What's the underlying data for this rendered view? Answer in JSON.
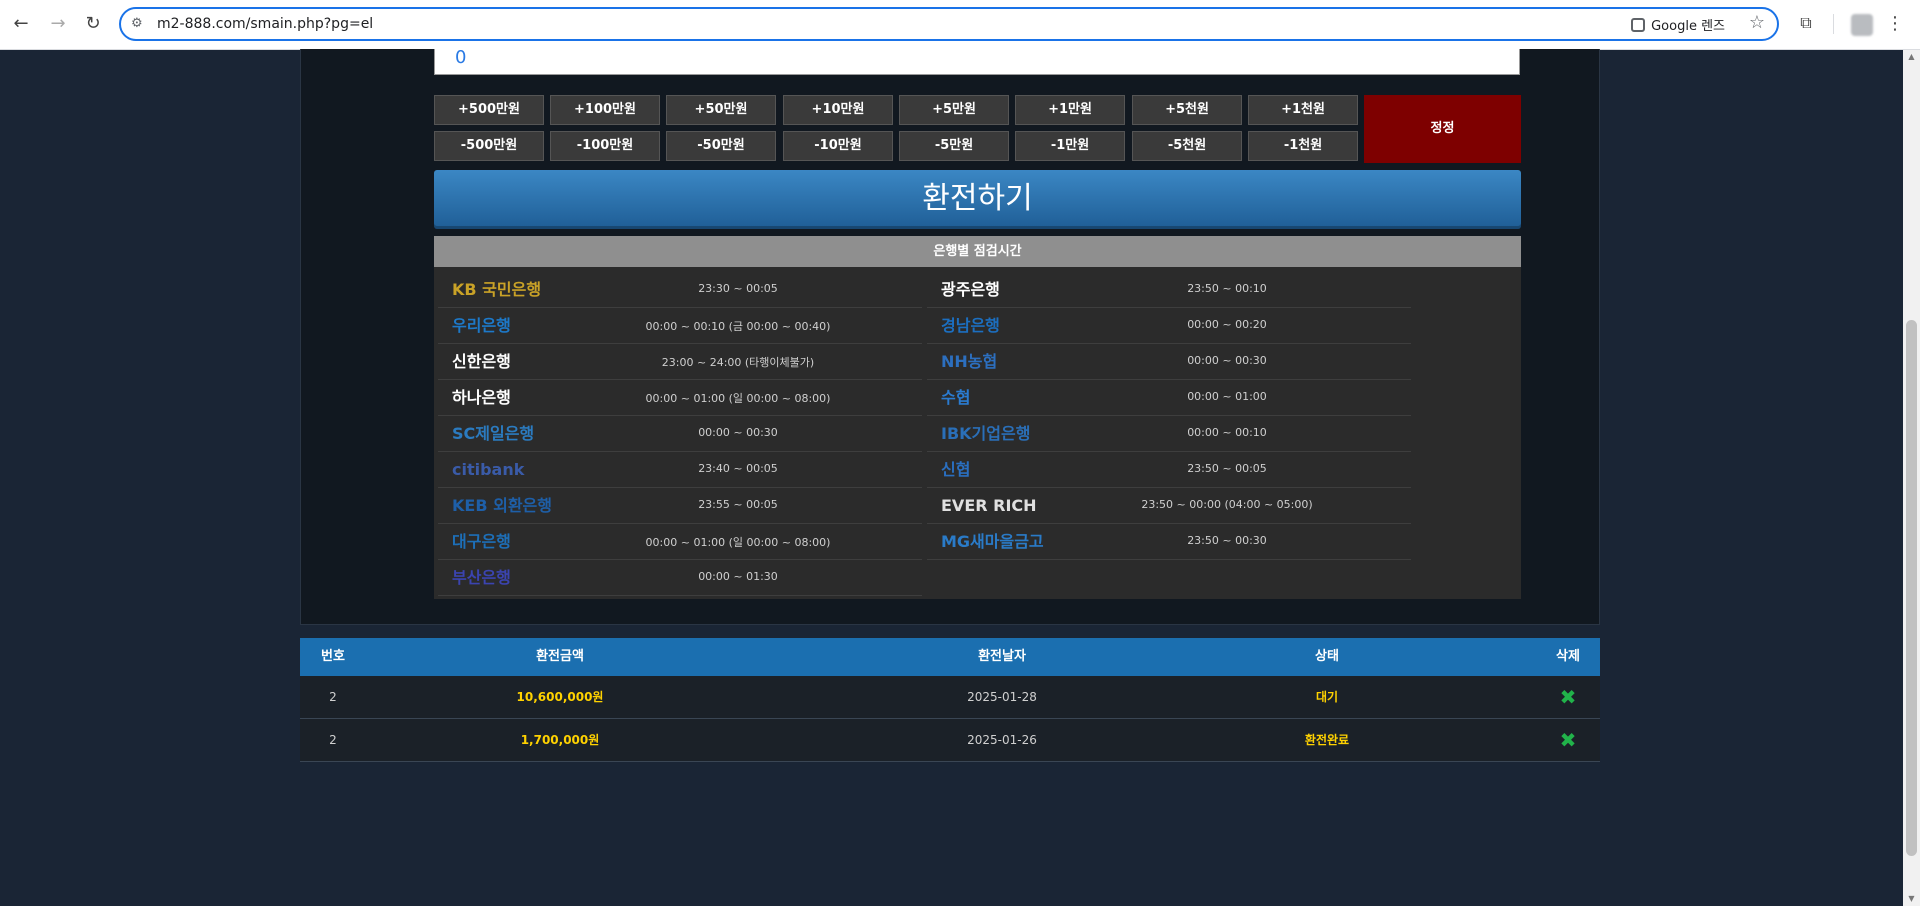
{
  "browser": {
    "url": "m2-888.com/smain.php?pg=el",
    "lens_label": "Google 렌즈",
    "icons": [
      "back-icon",
      "forward-icon",
      "reload-icon",
      "site-settings-icon",
      "lens-icon",
      "star-icon",
      "extensions-icon",
      "menu-icon"
    ]
  },
  "exchange": {
    "amount_value": "0",
    "plus_buttons": [
      "+500만원",
      "+100만원",
      "+50만원",
      "+10만원",
      "+5만원",
      "+1만원",
      "+5천원",
      "+1천원"
    ],
    "minus_buttons": [
      "-500만원",
      "-100만원",
      "-50만원",
      "-10만원",
      "-5만원",
      "-1만원",
      "-5천원",
      "-1천원"
    ],
    "reset_label": "정정",
    "submit_label": "환전하기"
  },
  "maintenance": {
    "title": "은행별 점검시간",
    "left": [
      {
        "bank": "KB 국민은행",
        "time": "23:30 ~ 00:05",
        "color": "#c9a227"
      },
      {
        "bank": "우리은행",
        "time": "00:00 ~ 00:10 (금 00:00 ~ 00:40)",
        "color": "#1d79c9"
      },
      {
        "bank": "신한은행",
        "time": "23:00 ~ 24:00 (타행이체불가)",
        "color": "#ffffff"
      },
      {
        "bank": "하나은행",
        "time": "00:00 ~ 01:00 (일 00:00 ~ 08:00)",
        "color": "#ffffff"
      },
      {
        "bank": "SC제일은행",
        "time": "00:00 ~ 00:30",
        "color": "#2b7bc0"
      },
      {
        "bank": "citibank",
        "time": "23:40 ~ 00:05",
        "color": "#3a5ba8"
      },
      {
        "bank": "KEB 외환은행",
        "time": "23:55 ~ 00:05",
        "color": "#1e5fa8"
      },
      {
        "bank": "대구은행",
        "time": "00:00 ~ 01:00 (일 00:00 ~ 08:00)",
        "color": "#1d6fb8"
      },
      {
        "bank": "부산은행",
        "time": "00:00 ~ 01:30",
        "color": "#3b44b0"
      }
    ],
    "right": [
      {
        "bank": "광주은행",
        "time": "23:50 ~ 00:10",
        "color": "#ffffff"
      },
      {
        "bank": "경남은행",
        "time": "00:00 ~ 00:20",
        "color": "#1c6fc0"
      },
      {
        "bank": "NH농협",
        "time": "00:00 ~ 00:30",
        "color": "#2c6fbf"
      },
      {
        "bank": "수협",
        "time": "00:00 ~ 01:00",
        "color": "#2a7bd0"
      },
      {
        "bank": "IBK기업은행",
        "time": "00:00 ~ 00:10",
        "color": "#2a6fb8"
      },
      {
        "bank": "신협",
        "time": "23:50 ~ 00:05",
        "color": "#2a6fc0"
      },
      {
        "bank": "EVER RICH",
        "time": "23:50 ~ 00:00 (04:00 ~ 05:00)",
        "color": "#e0e0e0"
      },
      {
        "bank": "MG새마을금고",
        "time": "23:50 ~ 00:30",
        "color": "#2a7bc8"
      }
    ]
  },
  "history": {
    "headers": [
      "번호",
      "환전금액",
      "환전날자",
      "상태",
      "삭제"
    ],
    "rows": [
      {
        "no": "2",
        "amount": "10,600,000원",
        "date": "2025-01-28",
        "status": "대기"
      },
      {
        "no": "2",
        "amount": "1,700,000원",
        "date": "2025-01-26",
        "status": "환전완료"
      }
    ]
  }
}
